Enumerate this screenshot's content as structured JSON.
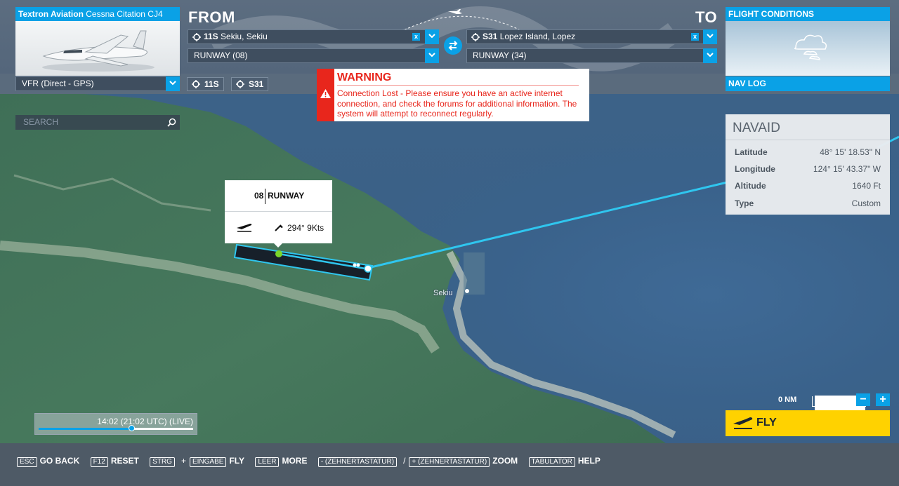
{
  "aircraft": {
    "maker": "Textron Aviation",
    "model": "Cessna Citation CJ4"
  },
  "route": {
    "from_label": "FROM",
    "to_label": "TO",
    "departure": {
      "code": "11S",
      "name": "Sekiu, Sekiu",
      "runway": "RUNWAY (08)"
    },
    "arrival": {
      "code": "S31",
      "name": "Lopez Island, Lopez",
      "runway": "RUNWAY (34)"
    },
    "clear_symbol": "x"
  },
  "flight_conditions": {
    "label": "FLIGHT CONDITIONS"
  },
  "flight_type": {
    "value": "VFR (Direct - GPS)"
  },
  "waypoint_chips": [
    "11S",
    "S31"
  ],
  "nav_log": {
    "label": "NAV LOG"
  },
  "warning": {
    "title": "WARNING",
    "message": "Connection Lost - Please ensure you have an active internet connection, and check the forums for additional information. The system will attempt to reconnect regularly."
  },
  "search": {
    "placeholder": "SEARCH"
  },
  "navaid": {
    "title": "NAVAID",
    "rows": [
      {
        "key": "Latitude",
        "value": "48° 15' 18.53\" N"
      },
      {
        "key": "Longitude",
        "value": "124° 15' 43.37\" W"
      },
      {
        "key": "Altitude",
        "value": "1640 Ft"
      },
      {
        "key": "Type",
        "value": "Custom"
      }
    ]
  },
  "runway_popup": {
    "number": "08",
    "label": "RUNWAY",
    "wind": "294° 9Kts"
  },
  "map": {
    "place": "Sekiu",
    "scale": "0 NM"
  },
  "time": {
    "label": "14:02 (21:02 UTC) (LIVE)",
    "progress": 0.6
  },
  "zoom": {
    "minus": "−",
    "plus": "+"
  },
  "fly": {
    "label": "FLY"
  },
  "hints": [
    {
      "keys": [
        "ESC"
      ],
      "label": "GO BACK"
    },
    {
      "keys": [
        "F12"
      ],
      "label": "RESET"
    },
    {
      "keys": [
        "STRG",
        "EINGABE"
      ],
      "op": "+",
      "label": "FLY"
    },
    {
      "keys": [
        "LEER"
      ],
      "label": "MORE"
    },
    {
      "keys": [
        "- (ZEHNERTASTATUR)",
        "+ (ZEHNERTASTATUR)"
      ],
      "op": "/",
      "label": "ZOOM"
    },
    {
      "keys": [
        "TABULATOR"
      ],
      "label": "HELP"
    }
  ],
  "colors": {
    "accent": "#0aa1e6",
    "warning": "#e8261c",
    "fly": "#ffd200",
    "route": "#2fc6ef"
  }
}
